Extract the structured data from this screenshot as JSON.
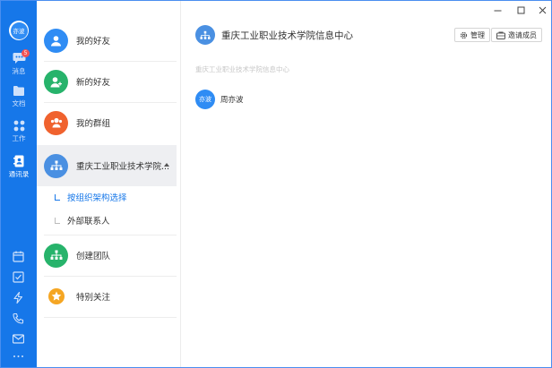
{
  "rail": {
    "avatar_text": "亦波",
    "items": [
      {
        "label": "消息",
        "badge": "5",
        "icon": "message-icon"
      },
      {
        "label": "文档",
        "icon": "document-icon"
      },
      {
        "label": "工作",
        "icon": "work-grid-icon"
      },
      {
        "label": "通讯录",
        "icon": "contacts-icon",
        "active": true
      }
    ],
    "bottom_icons": [
      "calendar-icon",
      "checklist-icon",
      "lightning-icon",
      "phone-icon",
      "mail-icon",
      "more-icon"
    ],
    "color": "#1677e9"
  },
  "contacts": {
    "items": [
      {
        "label": "我的好友",
        "color": "#2f8cf4",
        "icon": "person-icon"
      },
      {
        "label": "新的好友",
        "color": "#27b36b",
        "icon": "add-person-icon"
      },
      {
        "label": "我的群组",
        "color": "#f0622e",
        "icon": "group-icon"
      },
      {
        "label": "重庆工业职业技术学院...",
        "color": "#4a90e2",
        "icon": "org-tree-icon",
        "selected": true
      }
    ],
    "sub_items": [
      {
        "label": "按组织架构选择",
        "active": true
      },
      {
        "label": "外部联系人",
        "active": false
      }
    ],
    "extra_items": [
      {
        "label": "创建团队",
        "color": "#27b36b",
        "icon": "team-icon"
      },
      {
        "label": "特别关注",
        "color": "#f5a623",
        "icon": "star-icon"
      }
    ]
  },
  "org": {
    "title": "重庆工业职业技术学院信息中心",
    "manage_label": "管理",
    "invite_label": "邀请成员",
    "breadcrumb": "重庆工业职业技术学院信息中心",
    "members": [
      {
        "avatar_text": "亦波",
        "name": "周亦波"
      }
    ]
  }
}
